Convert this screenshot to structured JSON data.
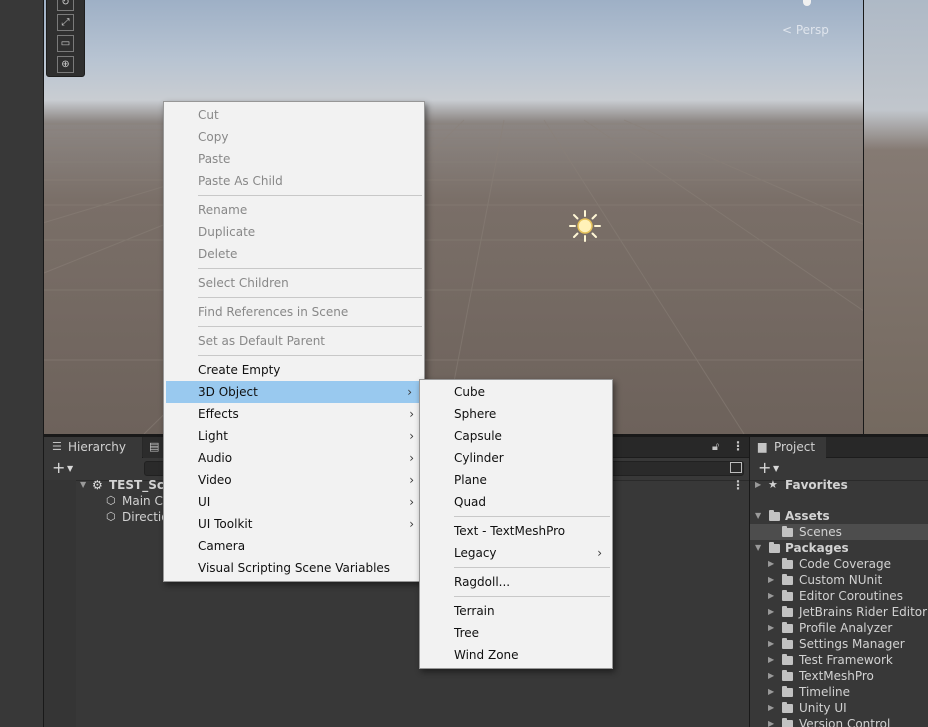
{
  "scene": {
    "persp_label": "< Persp",
    "toolbar_icons": [
      "rotate-tool-icon",
      "scale-tool-icon",
      "rect-tool-icon",
      "transform-tool-icon"
    ]
  },
  "context_menu": {
    "items": [
      {
        "label": "Cut",
        "enabled": false
      },
      {
        "label": "Copy",
        "enabled": false
      },
      {
        "label": "Paste",
        "enabled": false
      },
      {
        "label": "Paste As Child",
        "enabled": false
      },
      {
        "label": "Rename",
        "enabled": false
      },
      {
        "label": "Duplicate",
        "enabled": false
      },
      {
        "label": "Delete",
        "enabled": false
      },
      {
        "label": "Select Children",
        "enabled": false
      },
      {
        "label": "Find References in Scene",
        "enabled": false
      },
      {
        "label": "Set as Default Parent",
        "enabled": false
      },
      {
        "label": "Create Empty",
        "enabled": true
      },
      {
        "label": "3D Object",
        "enabled": true,
        "submenu": true,
        "highlighted": true
      },
      {
        "label": "Effects",
        "enabled": true,
        "submenu": true
      },
      {
        "label": "Light",
        "enabled": true,
        "submenu": true
      },
      {
        "label": "Audio",
        "enabled": true,
        "submenu": true
      },
      {
        "label": "Video",
        "enabled": true,
        "submenu": true
      },
      {
        "label": "UI",
        "enabled": true,
        "submenu": true
      },
      {
        "label": "UI Toolkit",
        "enabled": true,
        "submenu": true
      },
      {
        "label": "Camera",
        "enabled": true
      },
      {
        "label": "Visual Scripting Scene Variables",
        "enabled": true
      }
    ]
  },
  "submenu_3d_object": {
    "items": [
      {
        "label": "Cube"
      },
      {
        "label": "Sphere"
      },
      {
        "label": "Capsule"
      },
      {
        "label": "Cylinder"
      },
      {
        "label": "Plane"
      },
      {
        "label": "Quad"
      },
      {
        "label": "Text - TextMeshPro"
      },
      {
        "label": "Legacy",
        "submenu": true
      },
      {
        "label": "Ragdoll..."
      },
      {
        "label": "Terrain"
      },
      {
        "label": "Tree"
      },
      {
        "label": "Wind Zone"
      }
    ]
  },
  "hierarchy": {
    "tab_label": "Hierarchy",
    "scene_name": "TEST_Sce",
    "objects": [
      "Main Ca",
      "Directio"
    ]
  },
  "project": {
    "tab_label": "Project",
    "favorites_label": "Favorites",
    "assets_label": "Assets",
    "scenes_label": "Scenes",
    "packages_label": "Packages",
    "packages": [
      "Code Coverage",
      "Custom NUnit",
      "Editor Coroutines",
      "JetBrains Rider Editor",
      "Profile Analyzer",
      "Settings Manager",
      "Test Framework",
      "TextMeshPro",
      "Timeline",
      "Unity UI",
      "Version Control"
    ]
  },
  "colors": {
    "menu_bg": "#f2f2f2",
    "menu_highlight": "#99c9ef",
    "disabled_text": "#888888",
    "panel_bg": "#383838"
  }
}
